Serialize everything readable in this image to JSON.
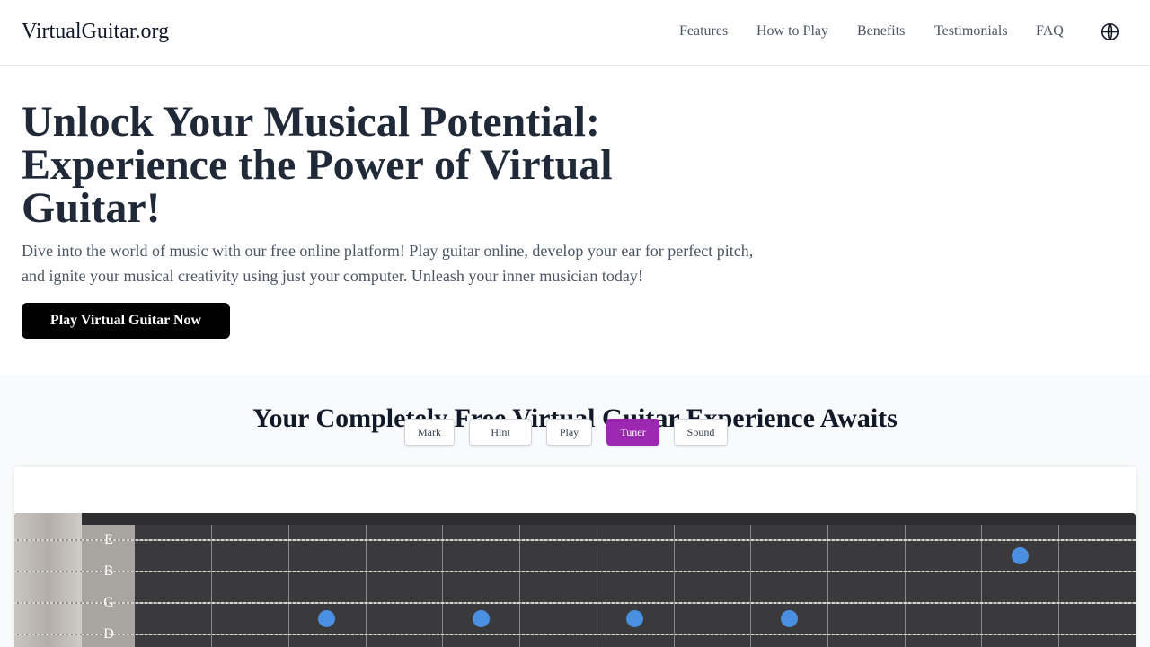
{
  "header": {
    "logo": "VirtualGuitar.org",
    "nav": [
      "Features",
      "How to Play",
      "Benefits",
      "Testimonials",
      "FAQ"
    ],
    "language_icon": "globe-icon"
  },
  "hero": {
    "title": "Unlock Your Musical Potential: Experience the Power of Virtual Guitar!",
    "subtitle": "Dive into the world of music with our free online platform! Play guitar online, develop your ear for perfect pitch, and ignite your musical creativity using just your computer. Unleash your inner musician today!",
    "cta_label": "Play Virtual Guitar Now"
  },
  "section": {
    "title": "Your Completely Free Virtual Guitar Experience Awaits"
  },
  "toolbar": {
    "buttons": [
      "Mark",
      "Hint",
      "Play",
      "Tuner",
      "Sound"
    ],
    "active": "Tuner"
  },
  "fretboard": {
    "strings": [
      "E",
      "B",
      "G",
      "D"
    ],
    "marker_color": "#4a8fe2"
  },
  "colors": {
    "accent": "#9c27b0",
    "cta_bg": "#000000"
  }
}
